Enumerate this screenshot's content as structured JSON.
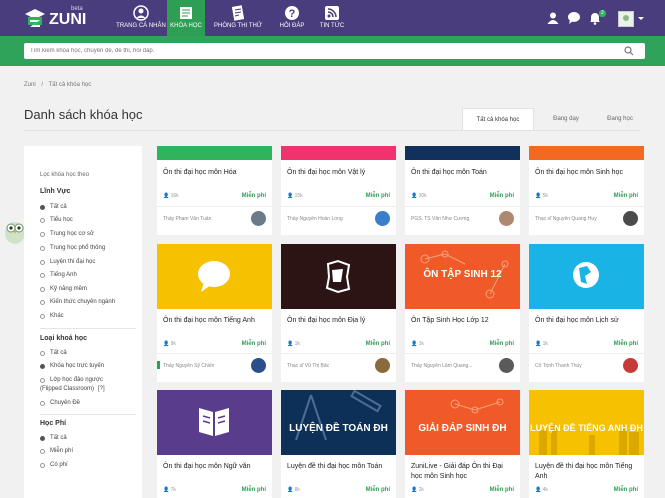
{
  "header": {
    "logo_text": "ZUNI",
    "beta": "beta",
    "nav": [
      {
        "label": "TRANG CÁ NHÂN",
        "icon": "person-circle-icon"
      },
      {
        "label": "KHÓA HỌC",
        "icon": "book-icon"
      },
      {
        "label": "PHÒNG THI THỬ",
        "icon": "exam-paper-icon"
      },
      {
        "label": "HỎI ĐÁP",
        "icon": "question-icon"
      },
      {
        "label": "TIN TỨC",
        "icon": "rss-icon"
      }
    ],
    "notification_count": "2",
    "colors": {
      "bar": "#4a3d7e",
      "active": "#2f9e55"
    }
  },
  "search": {
    "placeholder": "Tìm kiếm khóa học, chuyên đề, đề thi, hỏi đáp."
  },
  "breadcrumb": [
    "Zuni",
    "/",
    "Tất cả khóa học"
  ],
  "page_title": "Danh sách khóa học",
  "tabs": [
    "Tất cả khóa học",
    "Đang dạy",
    "Đang học"
  ],
  "sidebar": {
    "heading": "Lọc khóa học theo",
    "groups": [
      {
        "title": "Lĩnh Vực",
        "options": [
          "Tất cả",
          "Tiểu học",
          "Trung học cơ sở",
          "Trung học phổ thông",
          "Luyện thi đại học",
          "Tiếng Anh",
          "Kỹ năng mềm",
          "Kiến thức chuyên ngành",
          "Khác"
        ]
      },
      {
        "title": "Loại khoá học",
        "options": [
          "Tất cả",
          "Khóa học trực tuyến",
          "Lớp học đảo ngược",
          "(Flipped Classroom)",
          "[?]",
          "Chuyên Đề"
        ]
      },
      {
        "title": "Học Phí",
        "options": [
          "Tất cả",
          "Miễn phí",
          "Có phí"
        ]
      }
    ]
  },
  "courses": [
    {
      "title": "Ôn thi đại học môn Hóa",
      "count": "16k",
      "fee": "Miễn phí",
      "teacher": "Thầy Phạm Văn Tuấn",
      "color": "#2fb35d"
    },
    {
      "title": "Ôn thi đại học môn Vật lý",
      "count": "15k",
      "fee": "Miễn phí",
      "teacher": "Thầy Nguyễn Hoàn Long",
      "color": "#f0336e"
    },
    {
      "title": "Ôn thi đại học môn Toán",
      "count": "30k",
      "fee": "Miễn phí",
      "teacher": "PGS. TS Văn Như Cương",
      "color": "#12305c"
    },
    {
      "title": "Ôn thi đại học môn Sinh học",
      "count": "5k",
      "fee": "Miễn phí",
      "teacher": "Thạc sĩ Nguyễn Quang Huy",
      "color": "#f26a21"
    },
    {
      "title": "Ôn thi đại học môn Tiếng Anh",
      "count": "9k",
      "fee": "Miễn phí",
      "teacher": "Thầy Nguyễn Sỹ Chiến",
      "color": "#f6c100"
    },
    {
      "title": "Ôn thi đại học môn Địa lý",
      "count": "1k",
      "fee": "Miễn phí",
      "teacher": "Thạc sĩ Vũ Thị Bắc",
      "color": "#2d1414"
    },
    {
      "title": "Ôn Tập Sinh Học Lớp 12",
      "count": "1k",
      "fee": "Miễn phí",
      "teacher": "Thầy Nguyễn Lâm Quang...",
      "color": "#f05a28",
      "banner": "ÔN TẬP SINH 12"
    },
    {
      "title": "Ôn thi đại học môn Lịch sử",
      "count": "1k",
      "fee": "Miễn phí",
      "teacher": "Cô Trịnh Thanh Thủy",
      "color": "#1ab3e6"
    },
    {
      "title": "Ôn thi đại học môn Ngữ văn",
      "count": "7k",
      "fee": "Miễn phí",
      "teacher": "",
      "color": "#5a3c8c"
    },
    {
      "title": "Luyện đề thi đại học môn Toán",
      "count": "8k",
      "fee": "Miễn phí",
      "teacher": "",
      "color": "#0d3058",
      "banner": "LUYỆN ĐỀ TOÁN ĐH"
    },
    {
      "title": "ZuniLive - Giải đáp Ôn thi Đại học môn Sinh học",
      "count": "2k",
      "fee": "Miễn phí",
      "teacher": "",
      "color": "#f05a28",
      "banner": "GIẢI ĐÁP SINH ĐH"
    },
    {
      "title": "Luyện đề thi đại học môn Tiếng Anh",
      "count": "4k",
      "fee": "Miễn phí",
      "teacher": "",
      "color": "#f6c100",
      "banner": "LUYỆN ĐỀ TIẾNG ANH ĐH"
    }
  ]
}
